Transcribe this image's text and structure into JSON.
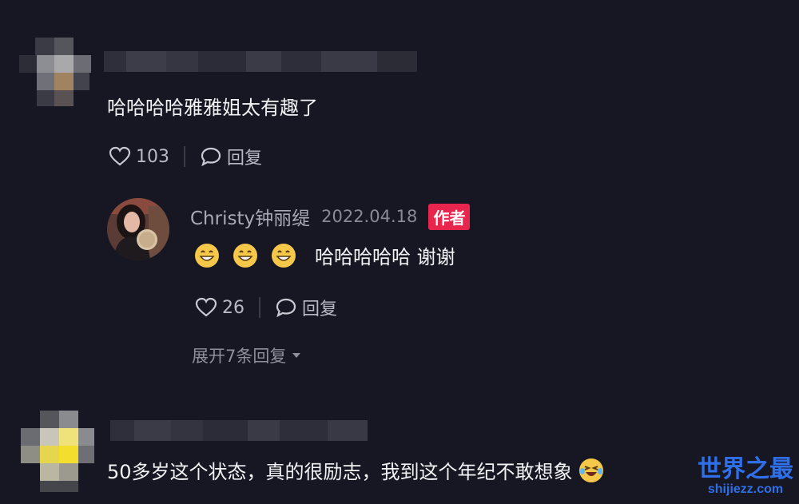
{
  "comments": [
    {
      "text": "哈哈哈哈雅雅姐太有趣了",
      "likes": "103",
      "reply_label": "回复",
      "reply": {
        "author": "Christy钟丽缇",
        "date": "2022.04.18",
        "author_badge": "作者",
        "text": "哈哈哈哈哈 谢谢",
        "likes": "26",
        "reply_label": "回复"
      },
      "expand_label": "展开7条回复"
    },
    {
      "text": "50多岁这个状态，真的很励志，我到这个年纪不敢想象"
    }
  ],
  "watermark": {
    "title": "世界之最",
    "url": "shijiezz.com"
  },
  "colors": {
    "background": "#161722",
    "badge": "#e8264d",
    "watermark": "#2f6fe8"
  }
}
